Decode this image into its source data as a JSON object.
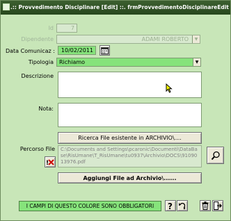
{
  "window": {
    "title": ".:: Provvedimento Disciplinare [Edit] ::.   frmProvvedimentoDisciplinareEdit © ing. ..."
  },
  "form": {
    "id": {
      "label": "Id",
      "value": "7"
    },
    "dipendente": {
      "label": "Dipendente",
      "value": "ADAMI  ROBERTO"
    },
    "data_comunicaz": {
      "label": "Data Comunicaz :",
      "value": "10/02/2011"
    },
    "tipologia": {
      "label": "Tipologia",
      "value": "Richiamo"
    },
    "descrizione": {
      "label": "Descrizione",
      "value": ""
    },
    "nota": {
      "label": "Nota:",
      "value": ""
    },
    "ricerca_button": "Ricerca File esistente in ARCHIVIO\\....",
    "percorso_file": {
      "label": "Percorso File",
      "value": "C:\\Documents and Settings\\pcaronic\\Documenti\\DataBase\\RisUmane\\T_RisUmane\\tu0937\\Archivio\\DOCS\\9109013976.pdf"
    },
    "aggiungi_button": "Aggiungi File ad Archivio\\......"
  },
  "footer": {
    "required_legend": "I CAMPI DI QUESTO COLORE SONO OBBLIGATORI"
  },
  "icons": {
    "calendar": "calendar-icon",
    "delete_file": "delete-file-icon",
    "search": "search-icon",
    "help": "help-icon",
    "undo": "undo-icon",
    "trash": "trash-icon",
    "exit": "exit-icon"
  },
  "colors": {
    "form_background": "#c8e6b8",
    "required_field": "#86e37b",
    "titlebar": "#27471d"
  }
}
